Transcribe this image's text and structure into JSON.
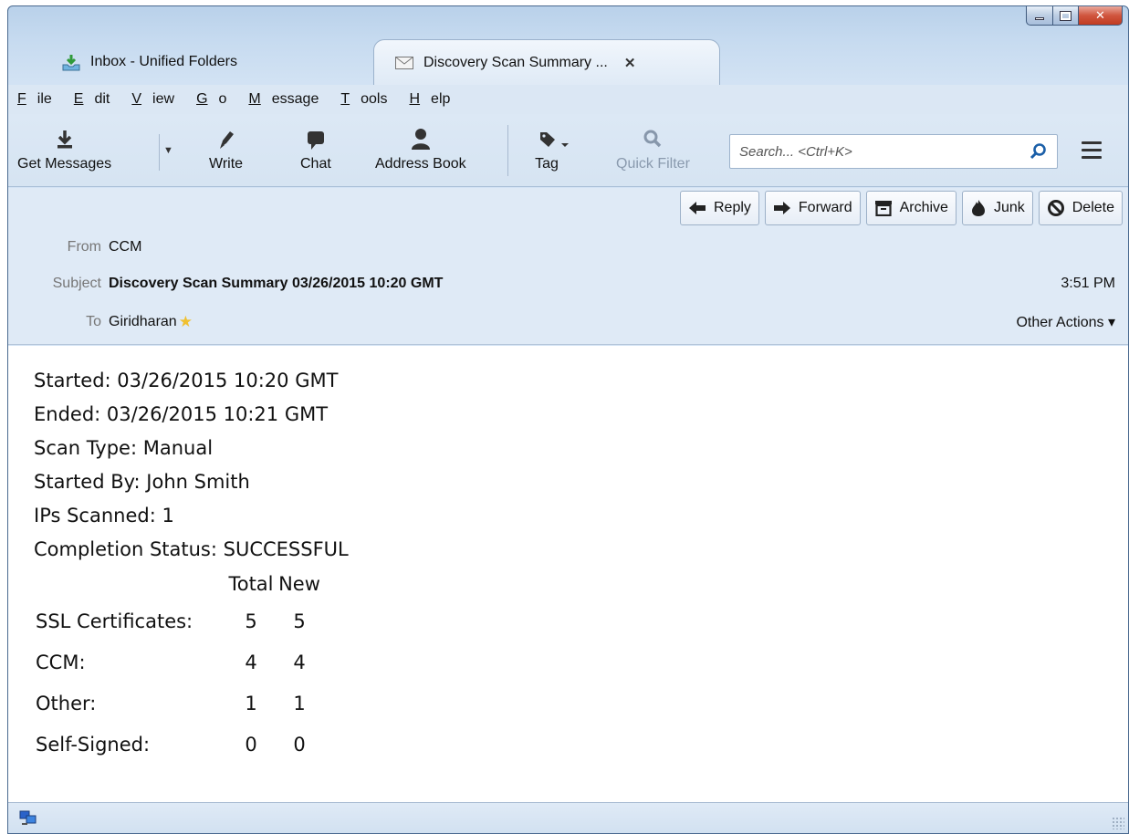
{
  "tabs": [
    {
      "label": "Inbox - Unified Folders",
      "icon": "inbox-download-icon"
    },
    {
      "label": "Discovery Scan Summary ...",
      "icon": "envelope-icon",
      "close": "✕"
    }
  ],
  "menu": {
    "items": [
      {
        "pre": "",
        "ul": "F",
        "post": "ile"
      },
      {
        "pre": "",
        "ul": "E",
        "post": "dit"
      },
      {
        "pre": "",
        "ul": "V",
        "post": "iew"
      },
      {
        "pre": "",
        "ul": "G",
        "post": "o"
      },
      {
        "pre": "",
        "ul": "M",
        "post": "essage"
      },
      {
        "pre": "",
        "ul": "T",
        "post": "ools"
      },
      {
        "pre": "",
        "ul": "H",
        "post": "elp"
      }
    ]
  },
  "toolbar": {
    "get_messages": "Get Messages",
    "write": "Write",
    "chat": "Chat",
    "address_book": "Address Book",
    "tag": "Tag",
    "quick_filter": "Quick Filter",
    "search_placeholder": "Search... <Ctrl+K>"
  },
  "actions": {
    "reply": "Reply",
    "forward": "Forward",
    "archive": "Archive",
    "junk": "Junk",
    "delete": "Delete"
  },
  "header": {
    "from_label": "From",
    "from_value": "CCM",
    "subject_label": "Subject",
    "subject_value": "Discovery Scan Summary 03/26/2015 10:20 GMT",
    "time": "3:51 PM",
    "to_label": "To",
    "to_value": "Giridharan",
    "other_actions": "Other Actions ▾"
  },
  "body": {
    "lines": [
      "Started: 03/26/2015 10:20 GMT",
      "Ended: 03/26/2015 10:21 GMT",
      "Scan Type: Manual",
      "Started By: John Smith",
      "IPs Scanned: 1",
      "Completion Status: SUCCESSFUL"
    ],
    "table": {
      "headers": [
        "",
        "Total",
        "New"
      ],
      "rows": [
        [
          "SSL Certificates:",
          "5",
          "5"
        ],
        [
          "CCM:",
          "4",
          "4"
        ],
        [
          "Other:",
          "1",
          "1"
        ],
        [
          "Self-Signed:",
          "0",
          "0"
        ]
      ]
    }
  },
  "colors": {
    "close_button": "#c13b21",
    "chrome": "#d3e3f4"
  }
}
